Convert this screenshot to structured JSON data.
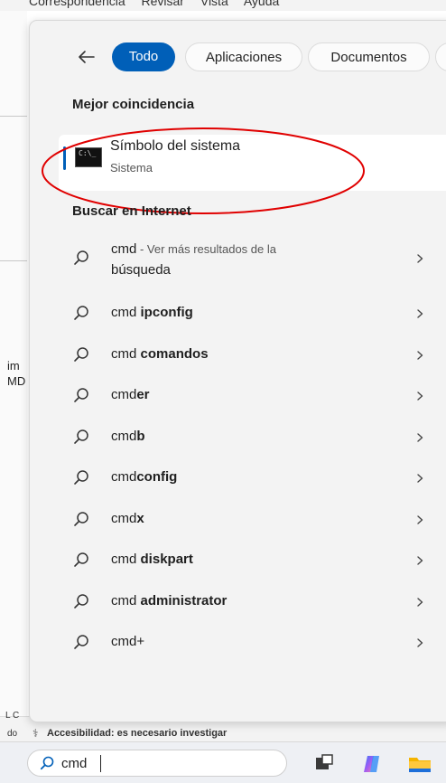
{
  "background": {
    "menu_items": "Correspondencia Revisar Vista Ayuda",
    "left_text_1": "im",
    "left_text_2": "MD",
    "status_prefix": "do",
    "status_line_prefix": "L C",
    "status_text": "Accesibilidad: es necesario investigar"
  },
  "filters": {
    "active": "Todo",
    "items": [
      "Aplicaciones",
      "Documentos"
    ]
  },
  "best_match": {
    "section_title": "Mejor coincidencia",
    "title": "Símbolo del sistema",
    "subtitle": "Sistema"
  },
  "web": {
    "section_title": "Buscar en Internet",
    "first": {
      "main": "cmd",
      "suffix": " - Ver más resultados de la",
      "second_line": "búsqueda"
    },
    "suggestions": [
      {
        "prefix": "cmd ",
        "bold": "ipconfig"
      },
      {
        "prefix": "cmd ",
        "bold": "comandos"
      },
      {
        "prefix": "cmd",
        "bold": "er"
      },
      {
        "prefix": "cmd",
        "bold": "b"
      },
      {
        "prefix": "cmd",
        "bold": "config"
      },
      {
        "prefix": "cmd",
        "bold": "x"
      },
      {
        "prefix": "cmd ",
        "bold": "diskpart"
      },
      {
        "prefix": "cmd ",
        "bold": "administrator"
      },
      {
        "prefix": "cmd+",
        "bold": ""
      }
    ]
  },
  "taskbar": {
    "search_value": "cmd",
    "icons": [
      "task-view-icon",
      "copilot-icon",
      "file-explorer-icon"
    ]
  },
  "colors": {
    "accent": "#005fb8",
    "annotation": "#e00000"
  }
}
